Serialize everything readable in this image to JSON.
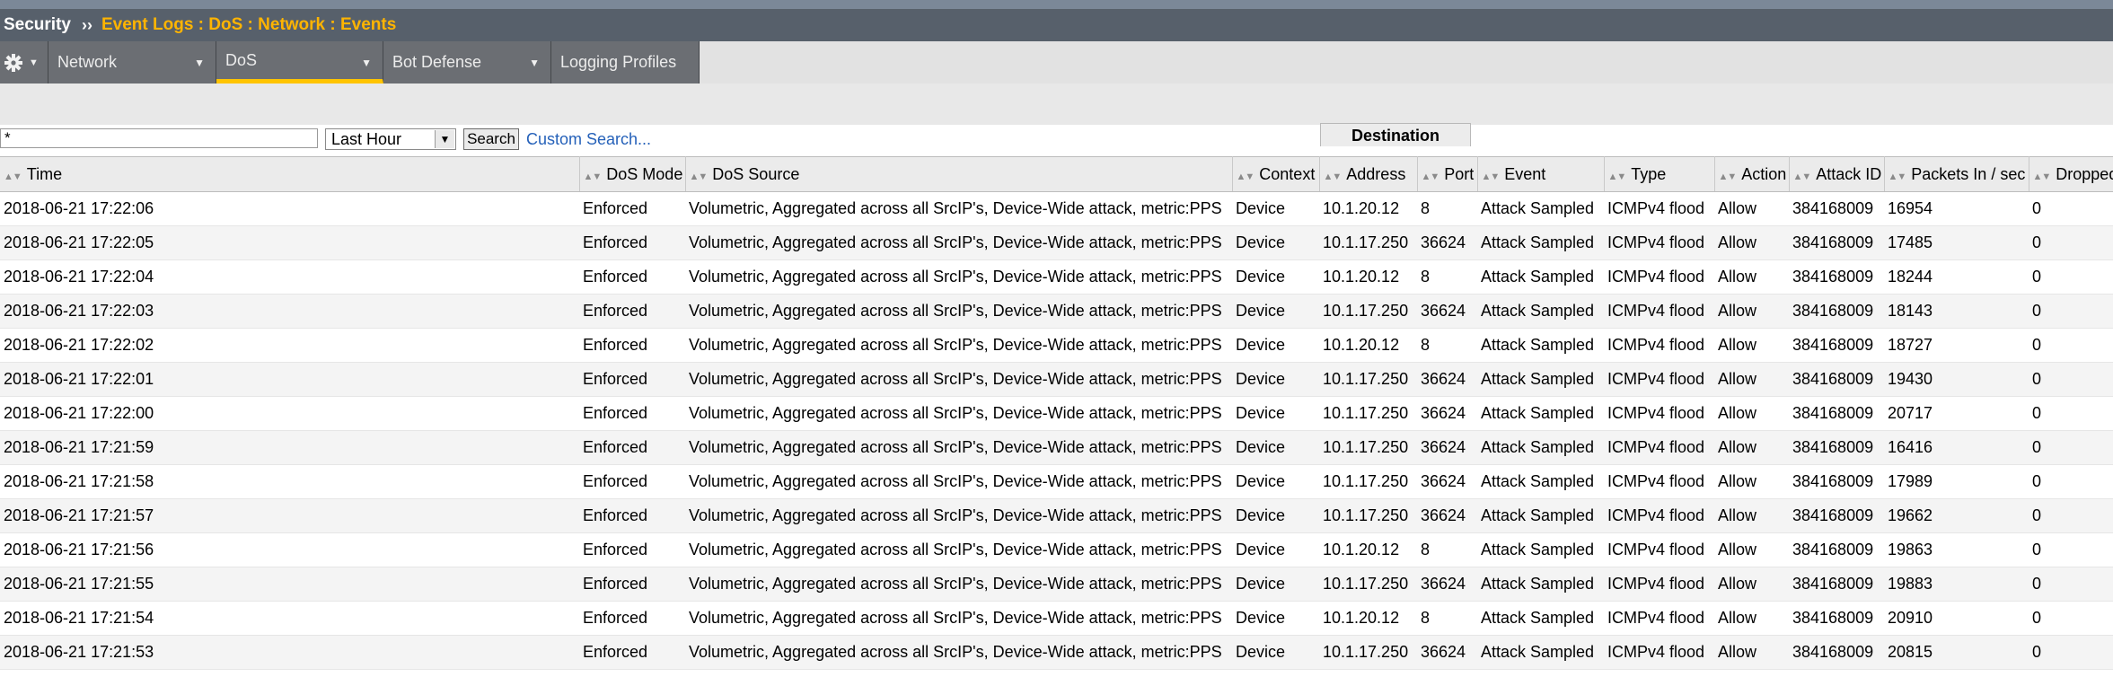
{
  "breadcrumb": {
    "home": "Security",
    "separator": "››",
    "path": "Event Logs : DoS : Network : Events"
  },
  "tabs": [
    {
      "label": "Network"
    },
    {
      "label": "DoS",
      "active": true
    },
    {
      "label": "Bot Defense"
    },
    {
      "label": "Logging Profiles"
    }
  ],
  "search": {
    "value": "*",
    "time_range": "Last Hour",
    "button": "Search",
    "custom_link": "Custom Search..."
  },
  "table": {
    "group_header": "Destination",
    "columns": [
      "Time",
      "DoS Mode",
      "DoS Source",
      "Context",
      "Address",
      "Port",
      "Event",
      "Type",
      "Action",
      "Attack ID",
      "Packets In / sec",
      "Dropped"
    ],
    "rows": [
      [
        "2018-06-21 17:22:06",
        "Enforced",
        "Volumetric, Aggregated across all SrcIP's, Device-Wide attack, metric:PPS",
        "Device",
        "10.1.20.12",
        "8",
        "Attack Sampled",
        "ICMPv4 flood",
        "Allow",
        "384168009",
        "16954",
        "0"
      ],
      [
        "2018-06-21 17:22:05",
        "Enforced",
        "Volumetric, Aggregated across all SrcIP's, Device-Wide attack, metric:PPS",
        "Device",
        "10.1.17.250",
        "36624",
        "Attack Sampled",
        "ICMPv4 flood",
        "Allow",
        "384168009",
        "17485",
        "0"
      ],
      [
        "2018-06-21 17:22:04",
        "Enforced",
        "Volumetric, Aggregated across all SrcIP's, Device-Wide attack, metric:PPS",
        "Device",
        "10.1.20.12",
        "8",
        "Attack Sampled",
        "ICMPv4 flood",
        "Allow",
        "384168009",
        "18244",
        "0"
      ],
      [
        "2018-06-21 17:22:03",
        "Enforced",
        "Volumetric, Aggregated across all SrcIP's, Device-Wide attack, metric:PPS",
        "Device",
        "10.1.17.250",
        "36624",
        "Attack Sampled",
        "ICMPv4 flood",
        "Allow",
        "384168009",
        "18143",
        "0"
      ],
      [
        "2018-06-21 17:22:02",
        "Enforced",
        "Volumetric, Aggregated across all SrcIP's, Device-Wide attack, metric:PPS",
        "Device",
        "10.1.20.12",
        "8",
        "Attack Sampled",
        "ICMPv4 flood",
        "Allow",
        "384168009",
        "18727",
        "0"
      ],
      [
        "2018-06-21 17:22:01",
        "Enforced",
        "Volumetric, Aggregated across all SrcIP's, Device-Wide attack, metric:PPS",
        "Device",
        "10.1.17.250",
        "36624",
        "Attack Sampled",
        "ICMPv4 flood",
        "Allow",
        "384168009",
        "19430",
        "0"
      ],
      [
        "2018-06-21 17:22:00",
        "Enforced",
        "Volumetric, Aggregated across all SrcIP's, Device-Wide attack, metric:PPS",
        "Device",
        "10.1.17.250",
        "36624",
        "Attack Sampled",
        "ICMPv4 flood",
        "Allow",
        "384168009",
        "20717",
        "0"
      ],
      [
        "2018-06-21 17:21:59",
        "Enforced",
        "Volumetric, Aggregated across all SrcIP's, Device-Wide attack, metric:PPS",
        "Device",
        "10.1.17.250",
        "36624",
        "Attack Sampled",
        "ICMPv4 flood",
        "Allow",
        "384168009",
        "16416",
        "0"
      ],
      [
        "2018-06-21 17:21:58",
        "Enforced",
        "Volumetric, Aggregated across all SrcIP's, Device-Wide attack, metric:PPS",
        "Device",
        "10.1.17.250",
        "36624",
        "Attack Sampled",
        "ICMPv4 flood",
        "Allow",
        "384168009",
        "17989",
        "0"
      ],
      [
        "2018-06-21 17:21:57",
        "Enforced",
        "Volumetric, Aggregated across all SrcIP's, Device-Wide attack, metric:PPS",
        "Device",
        "10.1.17.250",
        "36624",
        "Attack Sampled",
        "ICMPv4 flood",
        "Allow",
        "384168009",
        "19662",
        "0"
      ],
      [
        "2018-06-21 17:21:56",
        "Enforced",
        "Volumetric, Aggregated across all SrcIP's, Device-Wide attack, metric:PPS",
        "Device",
        "10.1.20.12",
        "8",
        "Attack Sampled",
        "ICMPv4 flood",
        "Allow",
        "384168009",
        "19863",
        "0"
      ],
      [
        "2018-06-21 17:21:55",
        "Enforced",
        "Volumetric, Aggregated across all SrcIP's, Device-Wide attack, metric:PPS",
        "Device",
        "10.1.17.250",
        "36624",
        "Attack Sampled",
        "ICMPv4 flood",
        "Allow",
        "384168009",
        "19883",
        "0"
      ],
      [
        "2018-06-21 17:21:54",
        "Enforced",
        "Volumetric, Aggregated across all SrcIP's, Device-Wide attack, metric:PPS",
        "Device",
        "10.1.20.12",
        "8",
        "Attack Sampled",
        "ICMPv4 flood",
        "Allow",
        "384168009",
        "20910",
        "0"
      ],
      [
        "2018-06-21 17:21:53",
        "Enforced",
        "Volumetric, Aggregated across all SrcIP's, Device-Wide attack, metric:PPS",
        "Device",
        "10.1.17.250",
        "36624",
        "Attack Sampled",
        "ICMPv4 flood",
        "Allow",
        "384168009",
        "20815",
        "0"
      ]
    ]
  }
}
